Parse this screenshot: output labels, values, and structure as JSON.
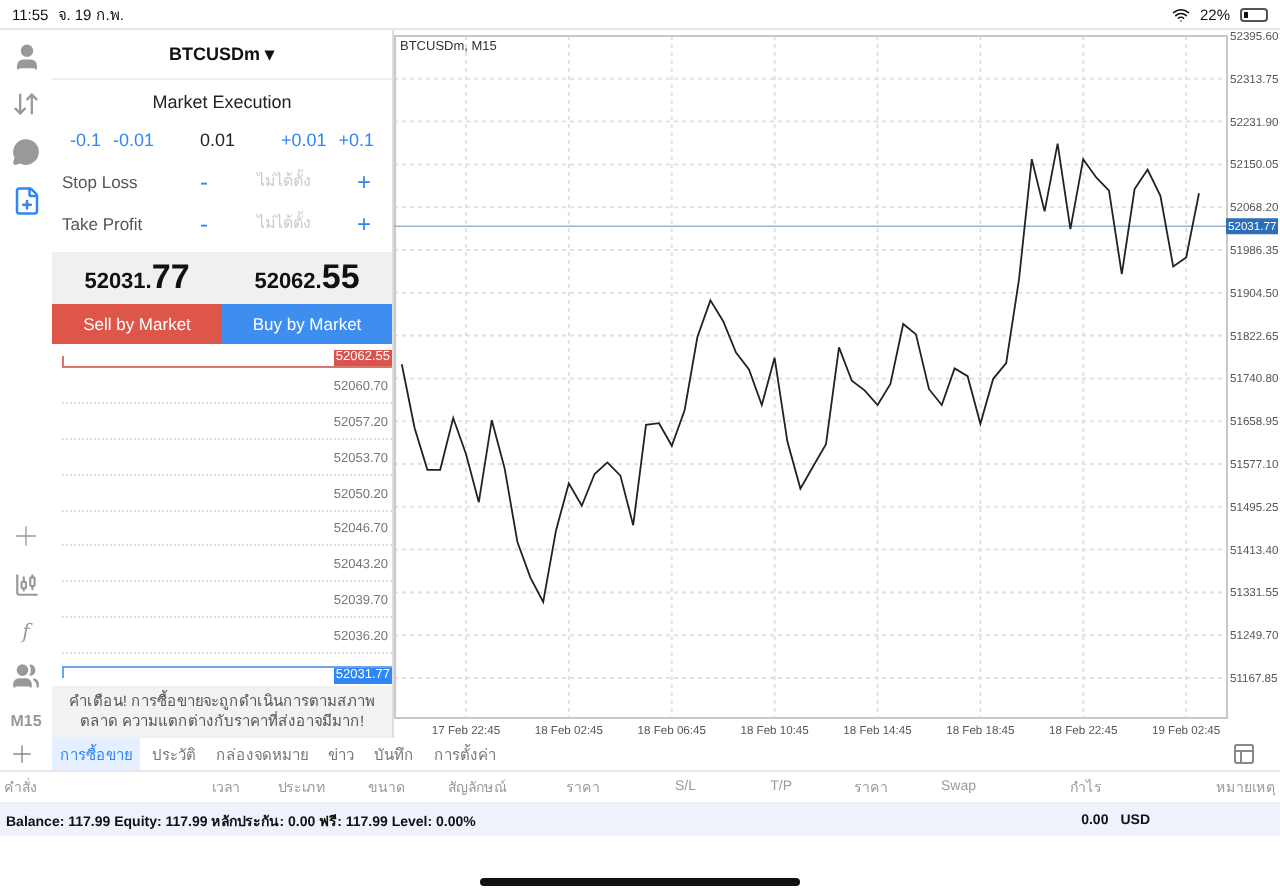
{
  "status_bar": {
    "time": "11:55",
    "date": "จ. 19 ก.พ.",
    "battery": "22%"
  },
  "rail": {
    "items": [
      {
        "kind": "account",
        "selected": false
      },
      {
        "kind": "trade",
        "selected": false
      },
      {
        "kind": "chat",
        "selected": false
      },
      {
        "kind": "new-order",
        "selected": true
      }
    ],
    "tools": [
      {
        "kind": "crosshair"
      },
      {
        "kind": "candles"
      },
      {
        "kind": "indicator",
        "label": "f"
      },
      {
        "kind": "objects"
      }
    ],
    "timeframe": "M15"
  },
  "order_panel": {
    "symbol": "BTCUSDm",
    "caret": "▾",
    "title": "Market Execution",
    "volume_down": [
      "-0.1",
      "-0.01"
    ],
    "volume": "0.01",
    "volume_up": [
      "+0.01",
      "+0.1"
    ],
    "stops": [
      {
        "label": "Stop Loss",
        "minus": "-",
        "value": "ไม่ได้ตั้ง",
        "plus": "+"
      },
      {
        "label": "Take Profit",
        "minus": "-",
        "value": "ไม่ได้ตั้ง",
        "plus": "+"
      }
    ],
    "bid": {
      "head": "52031.",
      "tail": "77"
    },
    "ask": {
      "head": "52062.",
      "tail": "55"
    },
    "sell_label": "Sell by Market",
    "buy_label": "Buy by Market",
    "ask_tag": "52062.55",
    "levels": [
      "52060.70",
      "52057.20",
      "52053.70",
      "52050.20",
      "52046.70",
      "52043.20",
      "52039.70",
      "52036.20"
    ],
    "bid_tag": "52031.77",
    "warning": "คำเตือน! การซื้อขายจะถูกดำเนินการตามสภาพตลาด ความแตกต่างกับราคาที่ส่งอาจมีมาก!"
  },
  "chart": {
    "title": "BTCUSDm, M15",
    "price_tag": "52031.77",
    "chart_data": {
      "type": "line",
      "grid": true,
      "ref_lines": [
        {
          "axis": "y",
          "value": 52031.77
        }
      ],
      "categories": [
        null,
        null,
        null,
        null,
        null,
        "17 Feb 22:45",
        null,
        null,
        null,
        null,
        null,
        null,
        null,
        "18 Feb 02:45",
        null,
        null,
        null,
        null,
        null,
        null,
        null,
        "18 Feb 06:45",
        null,
        null,
        null,
        null,
        null,
        null,
        null,
        "18 Feb 10:45",
        null,
        null,
        null,
        null,
        null,
        null,
        null,
        "18 Feb 14:45",
        null,
        null,
        null,
        null,
        null,
        null,
        null,
        "18 Feb 18:45",
        null,
        null,
        null,
        null,
        null,
        null,
        null,
        "18 Feb 22:45",
        null,
        null,
        null,
        null,
        null,
        null,
        null,
        "19 Feb 02:45",
        null
      ],
      "series": [
        {
          "color": "#222222",
          "values": [
            51768,
            51646,
            51566,
            51566,
            51665,
            51596,
            51504,
            51661,
            51569,
            51428,
            51360,
            51313,
            51450,
            51540,
            51497,
            51558,
            51580,
            51555,
            51460,
            51652,
            51655,
            51612,
            51680,
            51820,
            51890,
            51850,
            51790,
            51758,
            51690,
            51780,
            51620,
            51530,
            51573,
            51615,
            51800,
            51736,
            51718,
            51690,
            51730,
            51845,
            51825,
            51720,
            51690,
            51760,
            51745,
            51654,
            51740,
            51770,
            51930,
            52160,
            52060,
            52190,
            52026,
            52160,
            52125,
            52100,
            51940,
            52103,
            52140,
            52090,
            51955,
            51972,
            52095
          ]
        }
      ],
      "ylim": [
        51091.3,
        52395.6
      ],
      "yticks": [
        {
          "value": 52395.6,
          "label": "52395.60"
        },
        {
          "value": 52313.75,
          "label": "52313.75"
        },
        {
          "value": 52231.9,
          "label": "52231.90"
        },
        {
          "value": 52150.05,
          "label": "52150.05"
        },
        {
          "value": 52068.2,
          "label": "52068.20"
        },
        {
          "value": 51986.35,
          "label": "51986.35"
        },
        {
          "value": 51904.5,
          "label": "51904.50"
        },
        {
          "value": 51822.65,
          "label": "51822.65"
        },
        {
          "value": 51740.8,
          "label": "51740.80"
        },
        {
          "value": 51658.95,
          "label": "51658.95"
        },
        {
          "value": 51577.1,
          "label": "51577.10"
        },
        {
          "value": 51495.25,
          "label": "51495.25"
        },
        {
          "value": 51413.4,
          "label": "51413.40"
        },
        {
          "value": 51331.55,
          "label": "51331.55"
        },
        {
          "value": 51249.7,
          "label": "51249.70"
        },
        {
          "value": 51167.85,
          "label": "51167.85"
        }
      ]
    }
  },
  "tabs": [
    {
      "label": "การซื้อขาย",
      "selected": true
    },
    {
      "label": "ประวัติ",
      "selected": false
    },
    {
      "label": "กล่องจดหมาย",
      "selected": false
    },
    {
      "label": "ข่าว",
      "selected": false
    },
    {
      "label": "บันทึก",
      "selected": false
    },
    {
      "label": "การตั้งค่า",
      "selected": false
    }
  ],
  "table": {
    "columns": [
      "คำสั่ง",
      "เวลา",
      "ประเภท",
      "ขนาด",
      "สัญลักษณ์",
      "ราคา",
      "S/L",
      "T/P",
      "ราคา",
      "Swap",
      "กำไร",
      "หมายเหตุ"
    ]
  },
  "balance": {
    "summary": "Balance: 117.99 Equity: 117.99 หลักประกัน: 0.00 ฟรี: 117.99 Level: 0.00%",
    "profit": "0.00",
    "currency": "USD"
  }
}
